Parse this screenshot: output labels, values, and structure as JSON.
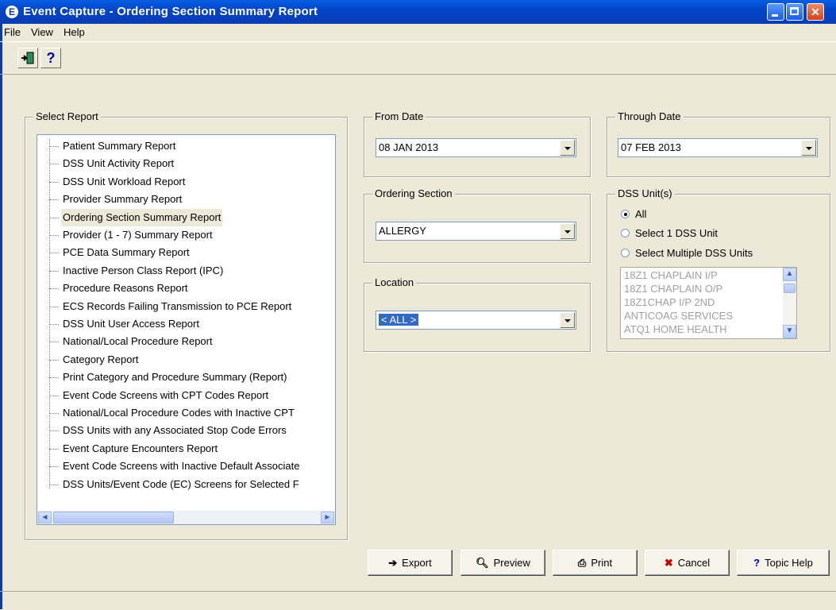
{
  "window": {
    "title": "Event Capture - Ordering Section Summary Report",
    "min": "",
    "max": "",
    "close": "✕"
  },
  "menu": {
    "file": "File",
    "view": "View",
    "help": "Help"
  },
  "toolbar": {
    "exit_icon": "exit-door-icon",
    "help_label": "?"
  },
  "select_report": {
    "legend": "Select Report",
    "items": [
      "Patient Summary Report",
      "DSS Unit Activity Report",
      "DSS Unit Workload Report",
      "Provider Summary Report",
      "Ordering Section Summary Report",
      "Provider (1 - 7) Summary Report",
      "PCE Data Summary Report",
      "Inactive Person Class Report (IPC)",
      "Procedure Reasons Report",
      "ECS Records Failing Transmission to PCE Report",
      "DSS Unit User Access Report",
      "National/Local Procedure Report",
      "Category Report",
      "Print Category and Procedure Summary (Report)",
      "Event Code Screens with CPT Codes Report",
      "National/Local Procedure Codes with Inactive CPT",
      "DSS Units with any Associated Stop Code Errors",
      "Event Capture Encounters Report",
      "Event Code Screens with Inactive Default Associate",
      "DSS Units/Event Code (EC) Screens for Selected F"
    ],
    "selected": "Ordering Section Summary Report",
    "scroll_left": "◄",
    "scroll_right": "►"
  },
  "from_date": {
    "legend": "From Date",
    "value": "08 JAN 2013"
  },
  "through_date": {
    "legend": "Through Date",
    "value": "07 FEB 2013"
  },
  "ordering_section": {
    "legend": "Ordering Section",
    "value": "ALLERGY"
  },
  "location": {
    "legend": "Location",
    "value": "< ALL >"
  },
  "dss_units": {
    "legend": "DSS Unit(s)",
    "options": [
      "All",
      "Select 1 DSS Unit",
      "Select Multiple DSS Units"
    ],
    "selected": "All",
    "list": [
      "18Z1 CHAPLAIN I/P",
      "18Z1 CHAPLAIN O/P",
      "18Z1CHAP I/P 2ND",
      "ANTICOAG SERVICES",
      "ATQ1 HOME HEALTH"
    ],
    "scroll_up": "▲",
    "scroll_down": "▼"
  },
  "buttons": {
    "export": "Export",
    "preview": "Preview",
    "print": "Print",
    "cancel": "Cancel",
    "topic_help": "Topic Help"
  }
}
